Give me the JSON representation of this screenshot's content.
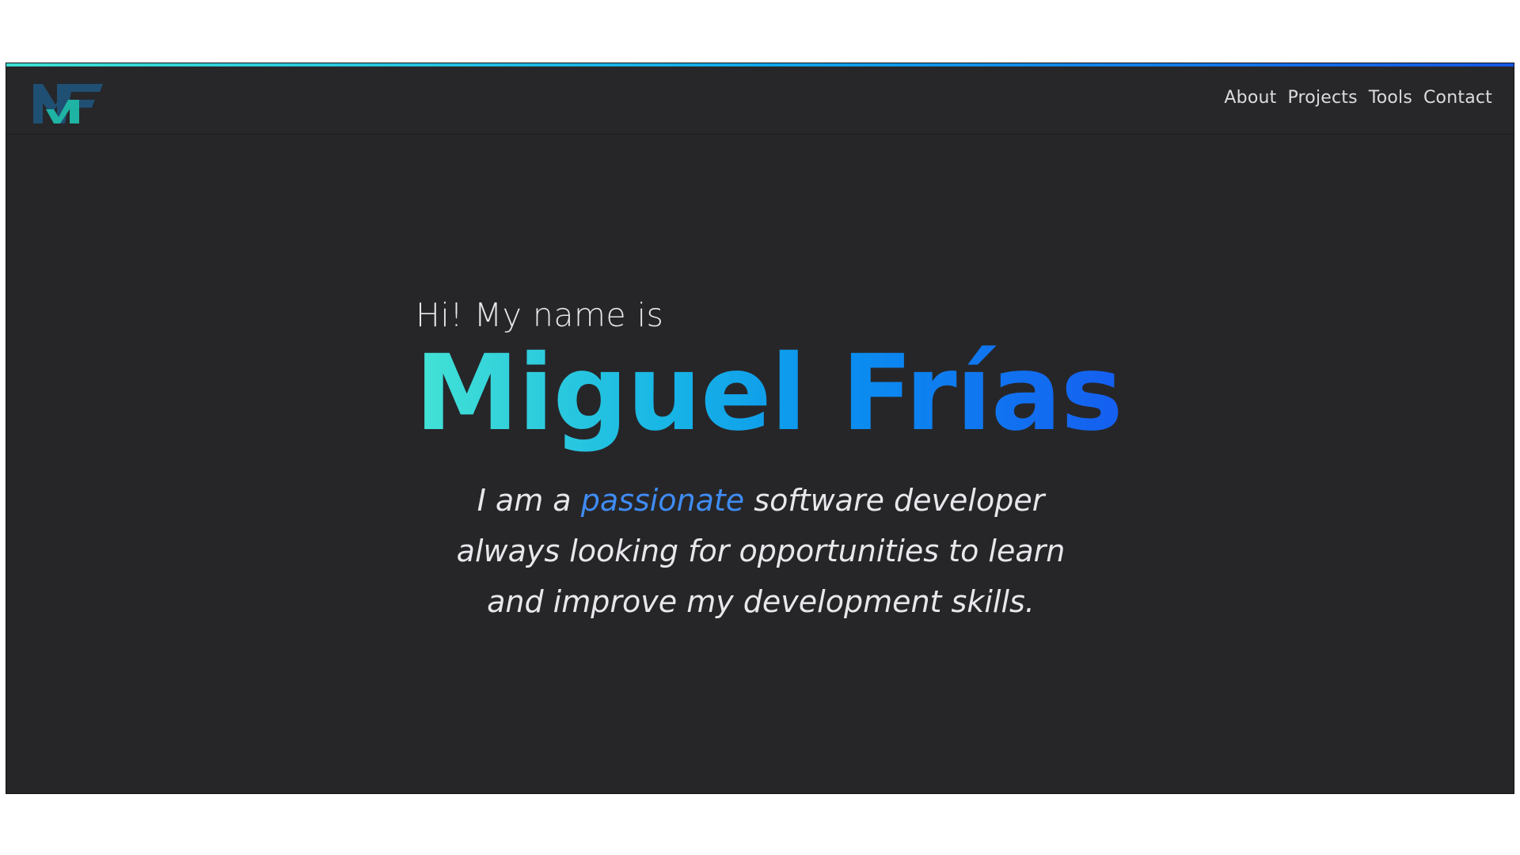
{
  "nav": {
    "logo_icon": "mf-logo-icon",
    "links": [
      {
        "label": "About"
      },
      {
        "label": "Projects"
      },
      {
        "label": "Tools"
      },
      {
        "label": "Contact"
      }
    ]
  },
  "hero": {
    "greeting": "Hi! My name is",
    "name": "Miguel Frías",
    "tagline": {
      "line1_before": "I am a",
      "highlight": "passionate",
      "line1_after": "software developer",
      "line2": "always looking for opportunities to learn",
      "line3": "and improve my development skills."
    },
    "scroll_icon": "chevron-down-icon"
  },
  "colors": {
    "background": "#262629",
    "accent_start": "#43e3d5",
    "accent_end": "#155ef0",
    "highlight": "#3f8cf4",
    "logo_dark": "#1f4f73",
    "logo_teal": "#1fb3a4"
  }
}
